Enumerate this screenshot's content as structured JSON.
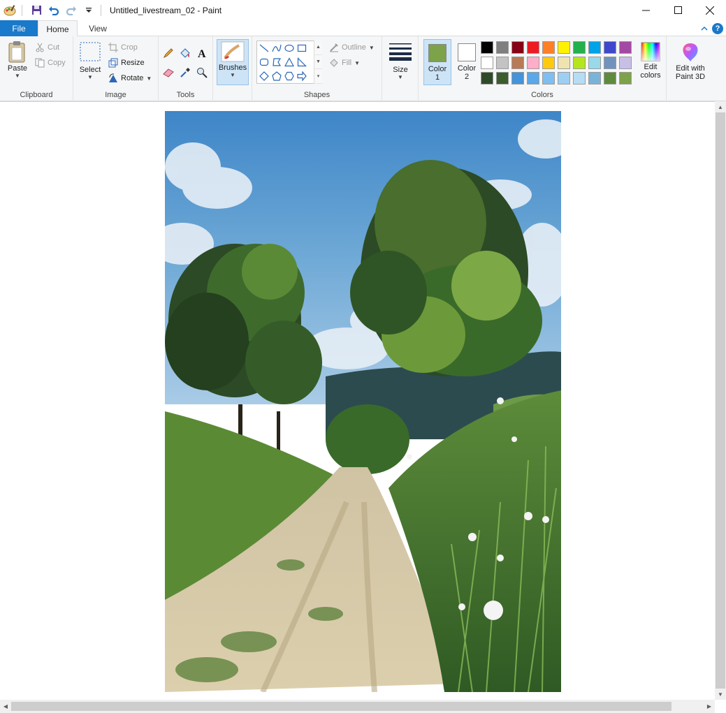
{
  "window": {
    "title": "Untitled_livestream_02 - Paint",
    "minimize_label": "",
    "maximize_label": "",
    "close_label": ""
  },
  "tabs": {
    "file": "File",
    "home": "Home",
    "view": "View"
  },
  "ribbon": {
    "clipboard": {
      "label": "Clipboard",
      "paste": "Paste",
      "cut": "Cut",
      "copy": "Copy"
    },
    "image": {
      "label": "Image",
      "select": "Select",
      "crop": "Crop",
      "resize": "Resize",
      "rotate": "Rotate"
    },
    "tools": {
      "label": "Tools"
    },
    "brushes": {
      "label": "Brushes"
    },
    "shapes": {
      "label": "Shapes",
      "outline": "Outline",
      "fill": "Fill"
    },
    "size": {
      "label": "Size"
    },
    "colors": {
      "label": "Colors",
      "color1": "Color",
      "color1_num": "1",
      "color2": "Color",
      "color2_num": "2",
      "color1_value": "#7ca24a",
      "color2_value": "#ffffff",
      "edit_colors_line1": "Edit",
      "edit_colors_line2": "colors",
      "paint3d_line1": "Edit with",
      "paint3d_line2": "Paint 3D",
      "palette": [
        "#000000",
        "#7f7f7f",
        "#880015",
        "#ed1c24",
        "#ff7f27",
        "#fff200",
        "#22b14c",
        "#00a2e8",
        "#3f48cc",
        "#a349a4",
        "#ffffff",
        "#c3c3c3",
        "#b97a57",
        "#ffaec9",
        "#ffc90e",
        "#efe4b0",
        "#b5e61d",
        "#99d9ea",
        "#7092be",
        "#c8bfe7",
        "#2f4a28",
        "#3c5c2e",
        "#4593d8",
        "#5aa7ea",
        "#7fbef0",
        "#9dcff3",
        "#b5ddf5",
        "#7ab3d8",
        "#5e8a3e",
        "#7ca24a"
      ]
    }
  },
  "canvas": {
    "image_description_icon": "landscape-painting"
  }
}
